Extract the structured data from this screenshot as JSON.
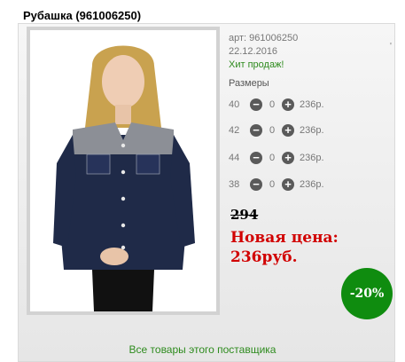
{
  "product": {
    "title": "Рубашка (961006250)",
    "article": "арт: 961006250",
    "date": "22.12.2016",
    "hit": "Хит продаж!",
    "tick": "'",
    "sizes_title": "Размеры",
    "sizes": [
      {
        "size": "40",
        "qty": "0",
        "price": "236р."
      },
      {
        "size": "42",
        "qty": "0",
        "price": "236р."
      },
      {
        "size": "44",
        "qty": "0",
        "price": "236р."
      },
      {
        "size": "38",
        "qty": "0",
        "price": "236р."
      }
    ],
    "old_price": "294",
    "new_price_label": "Новая цена:",
    "new_price_value": "236руб.",
    "discount": "-20%"
  },
  "supplier_link": "Все товары этого поставщика",
  "icons": {
    "minus": "minus-circle-icon",
    "plus": "plus-circle-icon"
  },
  "colors": {
    "hit": "#2e8b1e",
    "new_price": "#d10000",
    "discount_badge": "#0f8c0f"
  }
}
